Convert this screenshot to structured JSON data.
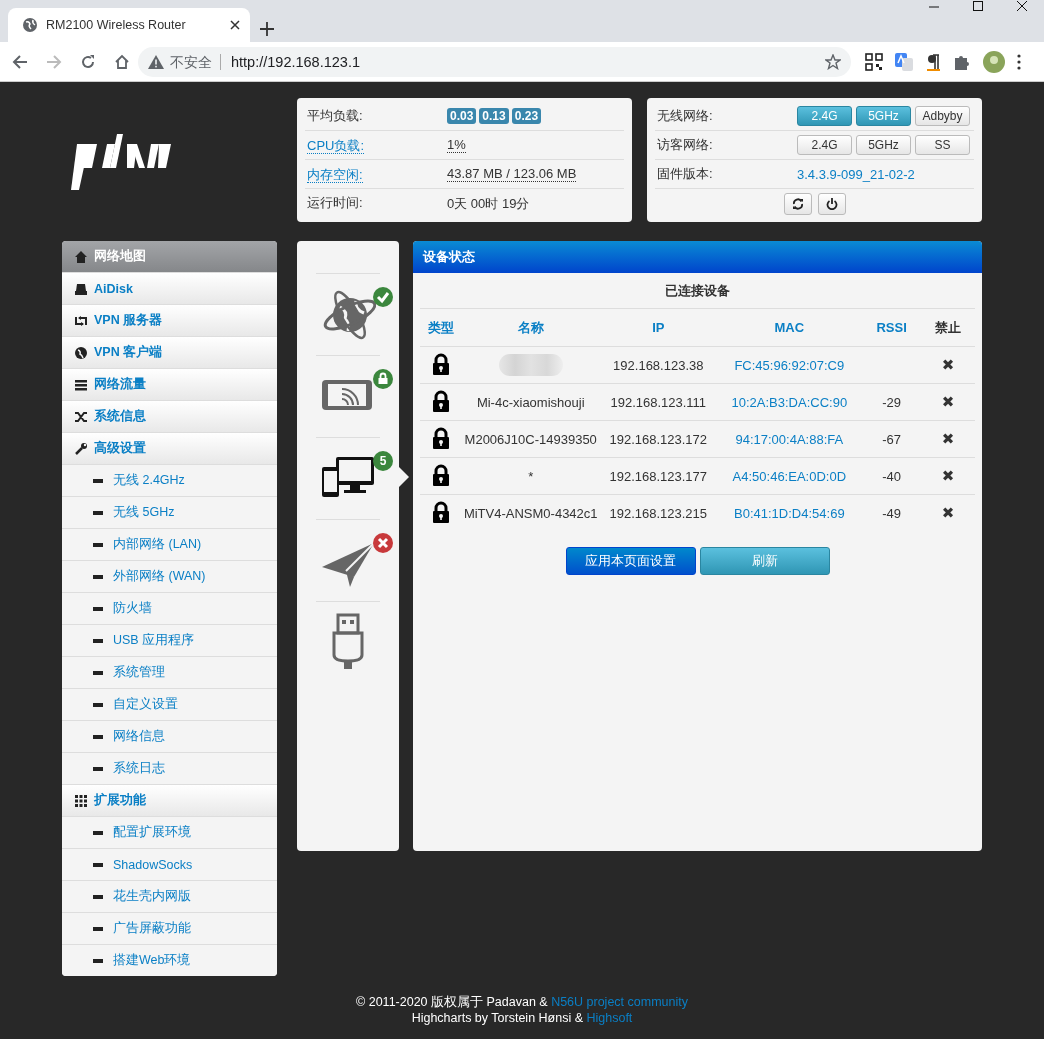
{
  "browser": {
    "tab_title": "RM2100 Wireless Router",
    "security": "不安全",
    "url": "http://192.168.123.1"
  },
  "status_left": [
    {
      "kind": "loads",
      "label": "平均负载:",
      "loads": [
        "0.03",
        "0.13",
        "0.23"
      ]
    },
    {
      "kind": "link",
      "label": "CPU负载:",
      "value": "1%"
    },
    {
      "kind": "link",
      "label": "内存空闲:",
      "value": "43.87 MB / 123.06 MB"
    },
    {
      "kind": "text",
      "label": "运行时间:",
      "value": "0天 00时 19分"
    }
  ],
  "status_right": [
    {
      "kind": "toggles",
      "label": "无线网络:",
      "buttons": [
        {
          "label": "2.4G",
          "on": true
        },
        {
          "label": "5GHz",
          "on": true
        },
        {
          "label": "Adbyby",
          "on": false
        }
      ]
    },
    {
      "kind": "toggles",
      "label": "访客网络:",
      "buttons": [
        {
          "label": "2.4G",
          "on": false
        },
        {
          "label": "5GHz",
          "on": false
        },
        {
          "label": "SS",
          "on": false
        }
      ]
    },
    {
      "kind": "firmware",
      "label": "固件版本:",
      "value": "3.4.3.9-099_21-02-2"
    },
    {
      "kind": "actions"
    }
  ],
  "menu": [
    {
      "label": "网络地图",
      "selected": true
    },
    {
      "label": "AiDisk",
      "selected": false
    },
    {
      "label": "VPN 服务器",
      "selected": false
    },
    {
      "label": "VPN 客户端",
      "selected": false
    },
    {
      "label": "网络流量",
      "selected": false
    },
    {
      "label": "系统信息",
      "selected": false
    },
    {
      "label": "高级设置",
      "selected": false,
      "children": [
        {
          "label": "无线 2.4GHz",
          "selected": false
        },
        {
          "label": "无线 5GHz",
          "selected": false
        },
        {
          "label": "内部网络 (LAN)",
          "selected": false
        },
        {
          "label": "外部网络 (WAN)",
          "selected": false
        },
        {
          "label": "防火墙",
          "selected": false
        },
        {
          "label": "USB 应用程序",
          "selected": false
        },
        {
          "label": "系统管理",
          "selected": false
        },
        {
          "label": "自定义设置",
          "selected": false
        },
        {
          "label": "网络信息",
          "selected": false
        },
        {
          "label": "系统日志",
          "selected": false
        }
      ]
    },
    {
      "label": "扩展功能",
      "selected": false,
      "children": [
        {
          "label": "配置扩展环境",
          "selected": false
        },
        {
          "label": "ShadowSocks",
          "selected": false
        },
        {
          "label": "花生壳内网版",
          "selected": false
        },
        {
          "label": "广告屏蔽功能",
          "selected": false
        },
        {
          "label": "搭建Web环境",
          "selected": false
        }
      ]
    }
  ],
  "rail": [
    {
      "selected": false,
      "badge": {
        "kind": "ok"
      }
    },
    {
      "selected": false,
      "badge": {
        "kind": "lock"
      }
    },
    {
      "selected": true,
      "badge": {
        "kind": "count",
        "text": "5"
      }
    },
    {
      "selected": false,
      "badge": {
        "kind": "error"
      }
    },
    {
      "selected": false
    }
  ],
  "panel": {
    "title": "设备状态",
    "subtitle": "已连接设备",
    "columns": [
      "类型",
      "名称",
      "IP",
      "MAC",
      "RSSI",
      "禁止"
    ],
    "rows": [
      {
        "redacted": true,
        "ip": "192.168.123.38",
        "mac": "FC:45:96:92:07:C9",
        "block": "✖"
      },
      {
        "redacted": false,
        "name": "Mi-4c-xiaomishouji",
        "ip": "192.168.123.111",
        "mac": "10:2A:B3:DA:CC:90",
        "rssi": "-29",
        "block": "✖"
      },
      {
        "redacted": false,
        "name": "M2006J10C-14939350",
        "ip": "192.168.123.172",
        "mac": "94:17:00:4A:88:FA",
        "rssi": "-67",
        "block": "✖"
      },
      {
        "redacted": false,
        "name": "*",
        "ip": "192.168.123.177",
        "mac": "A4:50:46:EA:0D:0D",
        "rssi": "-40",
        "block": "✖"
      },
      {
        "redacted": false,
        "name": "MiTV4-ANSM0-4342c1",
        "ip": "192.168.123.215",
        "mac": "B0:41:1D:D4:54:69",
        "rssi": "-49",
        "block": "✖"
      }
    ],
    "buttons": [
      {
        "kind": "primary",
        "label": "应用本页面设置"
      },
      {
        "kind": "info",
        "label": "刷新"
      }
    ]
  },
  "footer": [
    [
      {
        "text": "© 2011-2020 版权属于 Padavan & ",
        "link": false
      },
      {
        "text": "N56U project community",
        "link": true
      }
    ],
    [
      {
        "text": "Highcharts by Torstein Hønsi & ",
        "link": false
      },
      {
        "text": "Highsoft",
        "link": true
      }
    ]
  ]
}
